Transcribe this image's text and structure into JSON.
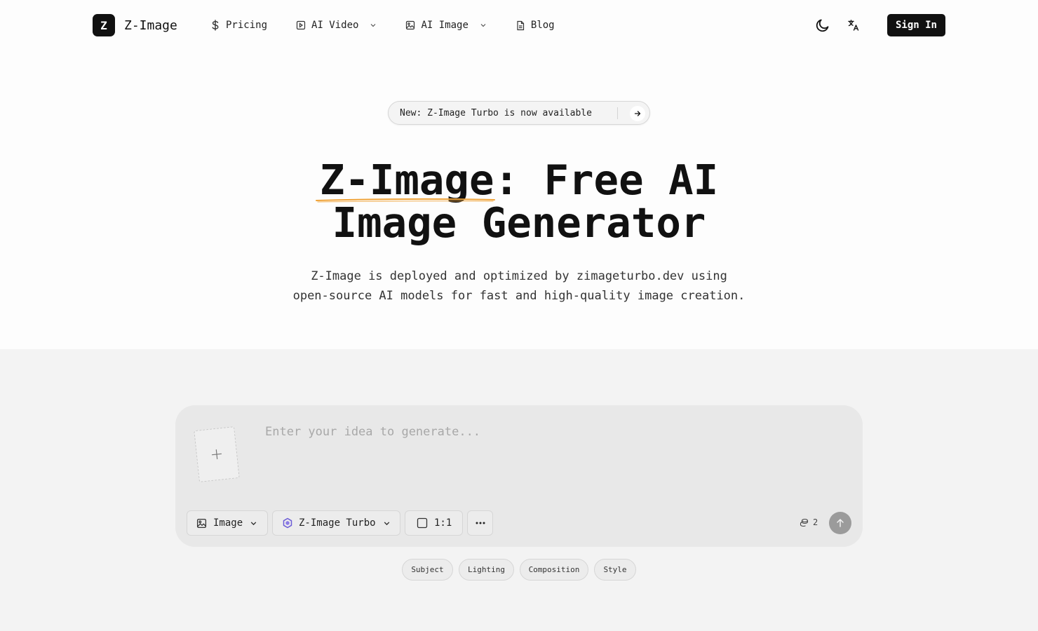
{
  "brand": {
    "mark": "Z",
    "name": "Z-Image"
  },
  "nav": {
    "items": [
      {
        "label": "Pricing",
        "icon": "dollar-icon"
      },
      {
        "label": "AI Video",
        "icon": "video-icon",
        "dropdown": true
      },
      {
        "label": "AI Image",
        "icon": "image-icon",
        "dropdown": true
      },
      {
        "label": "Blog",
        "icon": "document-icon"
      }
    ],
    "theme_icon": "moon-icon",
    "language_icon": "translate-icon",
    "sign_in": "Sign In"
  },
  "announcement": {
    "text": "New: Z-Image Turbo is now available",
    "icon": "arrow-right-icon"
  },
  "hero": {
    "title_highlight": "Z-Image",
    "title_rest_line1": ": Free AI",
    "title_line2": "Image Generator",
    "underline_color": "#f0a43a",
    "subtitle_line1": "Z-Image is deployed and optimized by zimageturbo.dev using",
    "subtitle_line2": "open-source AI models for fast and high-quality image creation."
  },
  "composer": {
    "placeholder": "Enter your idea to generate...",
    "upload_icon": "plus-icon",
    "mode": "Image",
    "model": "Z-Image Turbo",
    "model_icon_color": "#6b5bd6",
    "ratio": "1:1",
    "more_icon": "more-horizontal-icon",
    "credits": "2",
    "submit_icon": "arrow-up-icon"
  },
  "prompt_tags": [
    "Subject",
    "Lighting",
    "Composition",
    "Style"
  ]
}
